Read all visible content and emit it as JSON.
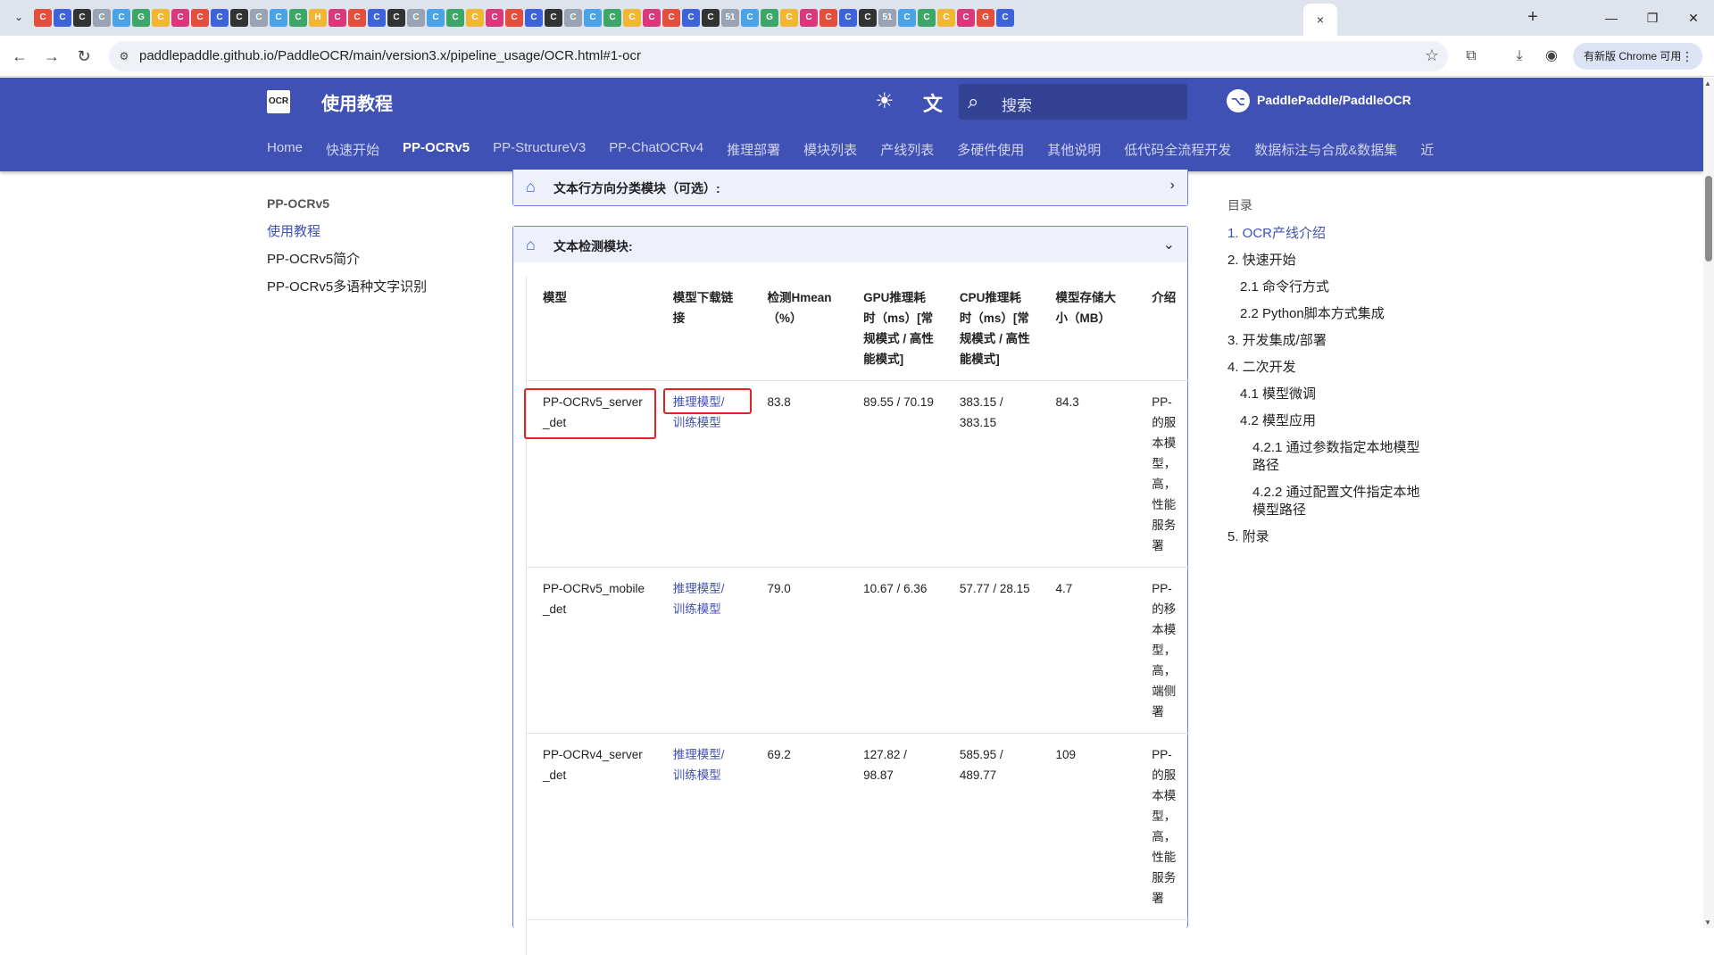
{
  "browser": {
    "active_tab_close": "×",
    "new_tab": "+",
    "url": "paddlepaddle.github.io/PaddleOCR/main/version3.x/pipeline_usage/OCR.html#1-ocr",
    "update_label": "有新版 Chrome 可用",
    "tab_favicons": [
      "C",
      "C",
      "C",
      "C",
      "C",
      "G",
      "C",
      "C",
      "C",
      "C",
      "C",
      "C",
      "C",
      "C",
      "H",
      "C",
      "C",
      "C",
      "C",
      "C",
      "C",
      "C",
      "C",
      "C",
      "C",
      "C",
      "C",
      "C",
      "C",
      "C",
      "C",
      "C",
      "C",
      "C",
      "C",
      "51",
      "C",
      "G",
      "C",
      "C",
      "C",
      "C",
      "C",
      "51",
      "C",
      "C",
      "C",
      "C",
      "G",
      "C"
    ]
  },
  "site": {
    "logo_text": "OCR",
    "title": "使用教程",
    "search_placeholder": "搜索",
    "repo_name": "PaddlePaddle/PaddleOCR",
    "nav_tabs": [
      "Home",
      "快速开始",
      "PP-OCRv5",
      "PP-StructureV3",
      "PP-ChatOCRv4",
      "推理部署",
      "模块列表",
      "产线列表",
      "多硬件使用",
      "其他说明",
      "低代码全流程开发",
      "数据标注与合成&数据集",
      "近"
    ],
    "active_nav": "PP-OCRv5"
  },
  "left_nav": {
    "title": "PP-OCRv5",
    "items": [
      "使用教程",
      "PP-OCRv5简介",
      "PP-OCRv5多语种文字识别"
    ]
  },
  "content": {
    "admon_collapsed_title": "文本行方向分类模块（可选）:",
    "admon_open_title": "文本检测模块:",
    "table": {
      "headers": [
        "模型",
        "模型下载链接",
        "检测Hmean（%）",
        "GPU推理耗时（ms）[常规模式 / 高性能模式]",
        "CPU推理耗时（ms）[常规模式 / 高性能模式]",
        "模型存储大小（MB）",
        "介绍"
      ],
      "rows": [
        {
          "model": "PP-OCRv5_server_det",
          "infer_link": "推理模型/",
          "train_link": "训练模型",
          "hmean": "83.8",
          "gpu": "89.55 / 70.19",
          "cpu": "383.15 / 383.15",
          "size": "84.3",
          "intro": "PP-的服本模型，高，性能服务署"
        },
        {
          "model": "PP-OCRv5_mobile_det",
          "infer_link": "推理模型/",
          "train_link": "训练模型",
          "hmean": "79.0",
          "gpu": "10.67 / 6.36",
          "cpu": "57.77 / 28.15",
          "size": "4.7",
          "intro": "PP-的移本模型，高，端侧署"
        },
        {
          "model": "PP-OCRv4_server_det",
          "infer_link": "推理模型/",
          "train_link": "训练模型",
          "hmean": "69.2",
          "gpu": "127.82 / 98.87",
          "cpu": "585.95 / 489.77",
          "size": "109",
          "intro": "PP-的服本模型，高，性能服务署"
        }
      ]
    }
  },
  "toc": {
    "title": "目录",
    "items": [
      {
        "label": "1. OCR产线介绍",
        "level": 1,
        "active": true
      },
      {
        "label": "2. 快速开始",
        "level": 1
      },
      {
        "label": "2.1 命令行方式",
        "level": 2
      },
      {
        "label": "2.2 Python脚本方式集成",
        "level": 2
      },
      {
        "label": "3. 开发集成/部署",
        "level": 1
      },
      {
        "label": "4. 二次开发",
        "level": 1
      },
      {
        "label": "4.1 模型微调",
        "level": 2
      },
      {
        "label": "4.2 模型应用",
        "level": 2
      },
      {
        "label": "4.2.1 通过参数指定本地模型路径",
        "level": 3
      },
      {
        "label": "4.2.2 通过配置文件指定本地模型路径",
        "level": 3
      },
      {
        "label": "5. 附录",
        "level": 1
      }
    ]
  },
  "colors": {
    "header_bg": "#4051b5",
    "link": "#4051b5",
    "highlight_box": "#e02424",
    "admon_border": "#6b7fe0"
  }
}
